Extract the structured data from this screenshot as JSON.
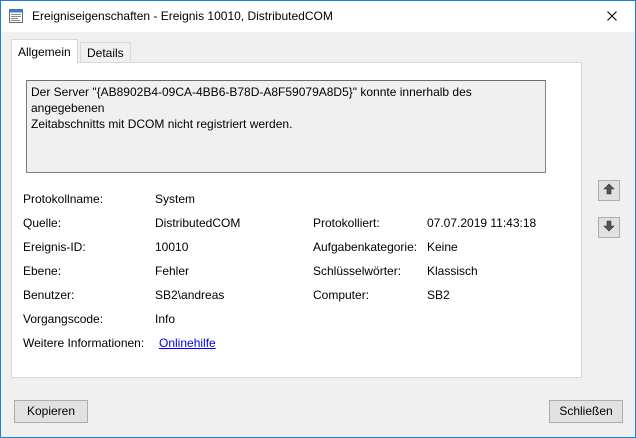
{
  "window": {
    "title": "Ereigniseigenschaften - Ereignis 10010, DistributedCOM"
  },
  "tabs": [
    {
      "label": "Allgemein",
      "active": true
    },
    {
      "label": "Details",
      "active": false
    }
  ],
  "description": "Der Server \"{AB8902B4-09CA-4BB6-B78D-A8F59079A8D5}\" konnte innerhalb des angegebenen\nZeitabschnitts mit DCOM nicht registriert werden.",
  "fields": {
    "protokollname": {
      "label": "Protokollname:",
      "value": "System"
    },
    "quelle": {
      "label": "Quelle:",
      "value": "DistributedCOM"
    },
    "protokolliert": {
      "label": "Protokolliert:",
      "value": "07.07.2019 11:43:18"
    },
    "ereignis_id": {
      "label": "Ereignis-ID:",
      "value": "10010"
    },
    "aufgabenkategorie": {
      "label": "Aufgabenkategorie:",
      "value": "Keine"
    },
    "ebene": {
      "label": "Ebene:",
      "value": "Fehler"
    },
    "schluesselwoerter": {
      "label": "Schlüsselwörter:",
      "value": "Klassisch"
    },
    "benutzer": {
      "label": "Benutzer:",
      "value": "SB2\\andreas"
    },
    "computer": {
      "label": "Computer:",
      "value": "SB2"
    },
    "vorgangscode": {
      "label": "Vorgangscode:",
      "value": "Info"
    },
    "weitere_informationen": {
      "label": "Weitere Informationen:",
      "link": "Onlinehilfe"
    }
  },
  "buttons": {
    "copy": "Kopieren",
    "close": "Schließen"
  },
  "icons": {
    "app": "event-viewer-icon",
    "close": "close-icon",
    "up": "arrow-up-icon",
    "down": "arrow-down-icon"
  },
  "colors": {
    "window_border": "#1883d7",
    "link": "#0000ee"
  }
}
